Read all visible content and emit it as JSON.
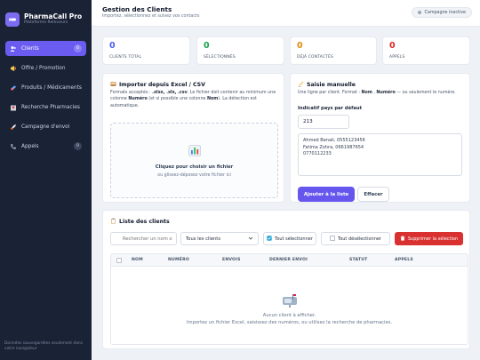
{
  "brand": {
    "name": "PharmaCall Pro",
    "subtitle": "Plateforme Releveurs"
  },
  "sidebar": {
    "items": [
      {
        "label": "Clients",
        "count": "0"
      },
      {
        "label": "Offre / Promotion"
      },
      {
        "label": "Produits / Médicaments"
      },
      {
        "label": "Recherche Pharmacies"
      },
      {
        "label": "Campagne d'envoi"
      },
      {
        "label": "Appels",
        "count": "0"
      }
    ],
    "footer": "Données sauvegardées seulement dans votre navigateur"
  },
  "header": {
    "title": "Gestion des Clients",
    "subtitle": "Importez, sélectionnez et suivez vos contacts",
    "campaign_status": "Campagne inactive"
  },
  "stats": [
    {
      "value": "0",
      "label": "CLIENTS TOTAL",
      "color": "#4a5cf0"
    },
    {
      "value": "0",
      "label": "SÉLECTIONNÉS",
      "color": "#15a34a"
    },
    {
      "value": "0",
      "label": "DÉJÀ CONTACTÉS",
      "color": "#e08a0b"
    },
    {
      "value": "0",
      "label": "APPELS",
      "color": "#dc2626"
    }
  ],
  "import_card": {
    "title": "Importer depuis Excel / CSV",
    "help_prefix": "Formats acceptés : ",
    "help_formats": ".xlsx, .xls, .csv",
    "help_middle": ". Le fichier doit contenir au minimum une colonne ",
    "help_col_numero": "Numéro",
    "help_middle2": " (et si possible une colonne ",
    "help_col_nom": "Nom",
    "help_suffix": "). La détection est automatique.",
    "dropzone_title": "Cliquez pour choisir un fichier",
    "dropzone_sub": "ou glissez-déposez votre fichier ici"
  },
  "manual_card": {
    "title": "Saisie manuelle",
    "help_prefix": "Une ligne par client. Format : ",
    "help_nom": "Nom",
    "help_sep": " , ",
    "help_numero": "Numéro",
    "help_suffix": " — ou seulement le numéro.",
    "prefix_label": "Indicatif pays par défaut",
    "prefix_value": "213",
    "numbers_value": "Ahmed Benali, 0555123456\nFatima Zohra, 0661987654\n0770112233",
    "add_button": "Ajouter à la liste",
    "clear_button": "Effacer"
  },
  "clients_list": {
    "title": "Liste des clients",
    "search_placeholder": "Rechercher un nom ou numéro",
    "filter_value": "Tous les clients",
    "select_all": "Tout sélectionner",
    "deselect_all": "Tout désélectionner",
    "delete_selection": "Supprimer la sélection",
    "columns": [
      "NOM",
      "NUMÉRO",
      "ENVOIS",
      "DERNIER ENVOI",
      "STATUT",
      "APPELS"
    ],
    "empty_title": "Aucun client à afficher.",
    "empty_sub": "Importez un fichier Excel, saisissez des numéros, ou utilisez la recherche de pharmacies."
  }
}
